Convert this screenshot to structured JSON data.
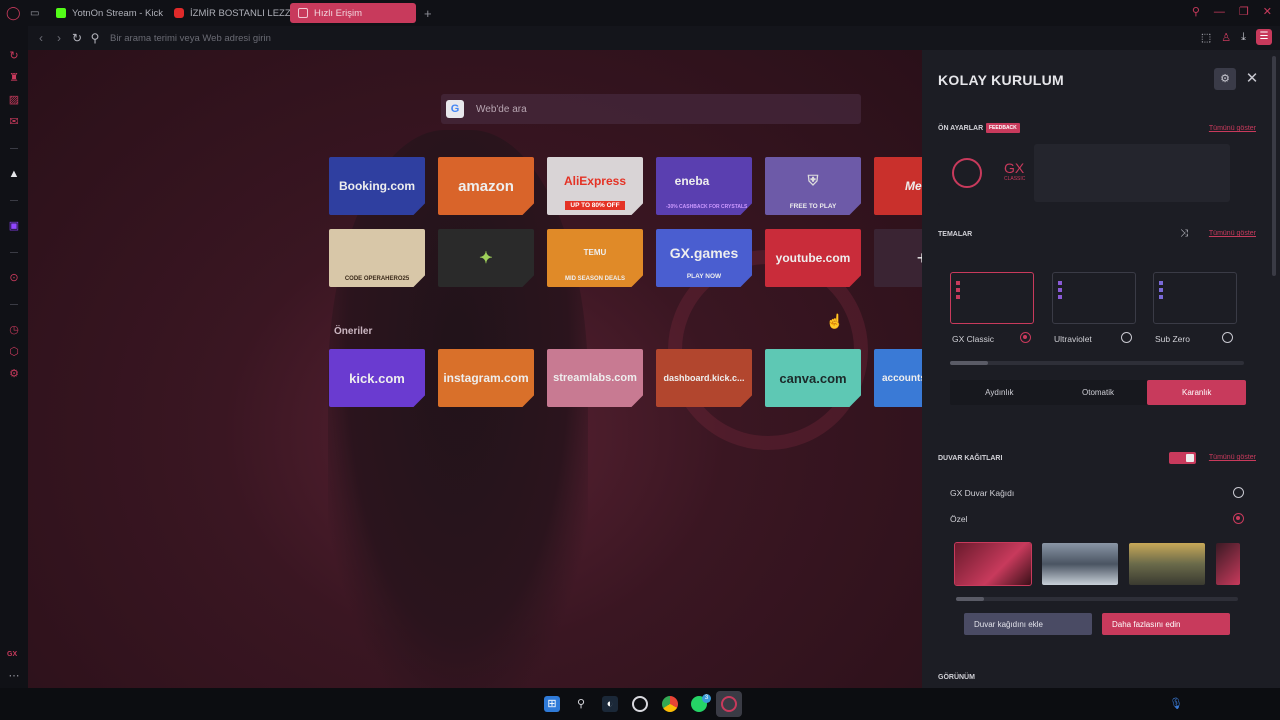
{
  "browser": {
    "tabs": [
      {
        "label": "",
        "icon": "opera-gx-logo-icon",
        "active": false
      },
      {
        "label": "",
        "icon": "workspace-icon",
        "active": false
      },
      {
        "label": "YotnOn Stream - Kick Da",
        "icon": "kick-icon",
        "active": false
      },
      {
        "label": "İZMİR BOSTANLI LEZZET",
        "icon": "youtube-icon",
        "active": false
      },
      {
        "label": "Hızlı Erişim",
        "icon": "speed-dial-icon",
        "active": true
      }
    ],
    "new_tab": "+",
    "address_placeholder": "Bir arama terimi veya Web adresi girin"
  },
  "speed_dial": {
    "search_placeholder": "Web'de ara",
    "search_logo": "G",
    "tiles_row1": [
      {
        "label": "Booking.com",
        "sub": "",
        "color": "#2f3fa0"
      },
      {
        "label": "amazon",
        "sub": "",
        "color": "#d9642a"
      },
      {
        "label": "AliExpress",
        "sub": "UP TO 80% OFF",
        "color": "#d9d4d6"
      },
      {
        "label": "eneba",
        "sub": "-30% CASHBACK FOR CRYSTALS",
        "color": "#5a3fb0"
      },
      {
        "label": "",
        "sub": "FREE TO PLAY",
        "color": "#6d5aa8"
      },
      {
        "label": "Media",
        "sub": "",
        "color": "#c9302c"
      }
    ],
    "tiles_row2": [
      {
        "label": "",
        "sub": "CODE OPERAHERO25",
        "color": "#d8c7a8"
      },
      {
        "label": "",
        "sub": "",
        "color": "#2a2a2a"
      },
      {
        "label": "TEMU",
        "sub": "MID SEASON DEALS",
        "color": "#e08a28"
      },
      {
        "label": "GX.games",
        "sub": "PLAY NOW",
        "color": "#4a5ed0"
      },
      {
        "label": "youtube.com",
        "sub": "",
        "color": "#c92c3a"
      },
      {
        "label": "+",
        "sub": "",
        "color": "#3a2433"
      }
    ],
    "suggestions_label": "Öneriler",
    "suggestions": [
      {
        "label": "kick.com",
        "color": "#6a3bd0"
      },
      {
        "label": "instagram.com",
        "color": "#d9702a"
      },
      {
        "label": "streamlabs.com",
        "color": "#c87a92"
      },
      {
        "label": "dashboard.kick.c...",
        "color": "#b2462e"
      },
      {
        "label": "canva.com",
        "color": "#5ec8b4"
      },
      {
        "label": "accounts.",
        "color": "#3a7ad6"
      }
    ]
  },
  "panel": {
    "title": "KOLAY KURULUM",
    "presets_label": "ÖN AYARLAR",
    "feedback": "FEEDBACK",
    "show_all": "Tümünü göster",
    "preset_gx": "GX",
    "preset_gx_sub": "CLASSIC",
    "themes_label": "TEMALAR",
    "themes": [
      {
        "name": "GX Classic",
        "selected": true,
        "color": "#c83a5c"
      },
      {
        "name": "Ultraviolet",
        "selected": false,
        "color": "#8a5ad6"
      },
      {
        "name": "Sub Zero",
        "selected": false,
        "color": "#7a6ad8"
      }
    ],
    "modes": [
      "Aydınlık",
      "Otomatik",
      "Karanlık"
    ],
    "active_mode": "Karanlık",
    "wallpapers_label": "DUVAR KAĞITLARI",
    "wallpaper_options": [
      {
        "label": "GX Duvar Kağıdı",
        "selected": false
      },
      {
        "label": "Özel",
        "selected": true
      }
    ],
    "add_wallpaper": "Duvar kağıdını ekle",
    "get_more": "Daha fazlasını edin",
    "appearance_label": "GÖRÜNÜM"
  },
  "colors": {
    "accent": "#c83a5c",
    "panel_bg": "#1c1d24",
    "chrome_bg": "#101116"
  },
  "taskbar": {
    "icons": [
      "windows-start-icon",
      "search-icon",
      "steam-icon",
      "opera-icon",
      "chrome-icon",
      "whatsapp-icon",
      "opera-gx-icon"
    ],
    "whatsapp_badge": "3"
  }
}
